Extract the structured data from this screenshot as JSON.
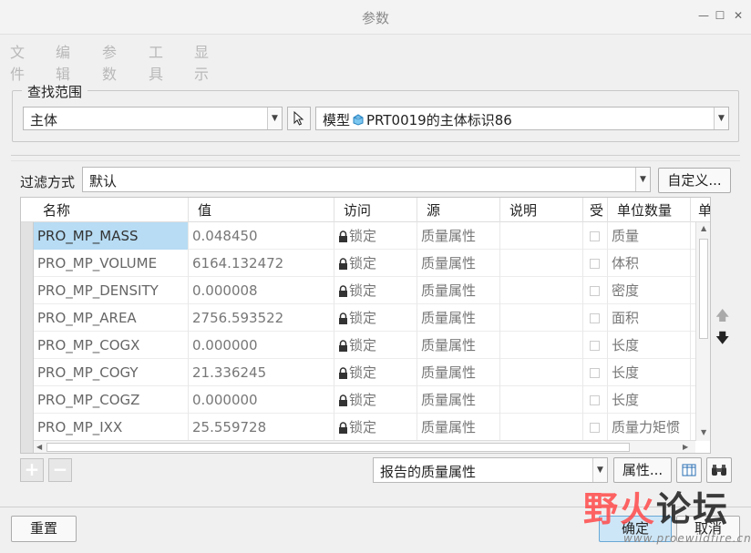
{
  "window": {
    "title": "参数"
  },
  "menu": [
    "文件",
    "编辑",
    "参数",
    "工具",
    "显示"
  ],
  "scope": {
    "legend": "查找范围",
    "selector_value": "主体",
    "model_prefix": "模型",
    "model_value": "PRT0019的主体标识86"
  },
  "filter": {
    "label": "过滤方式",
    "value": "默认",
    "customize_label": "自定义..."
  },
  "table": {
    "columns": [
      "名称",
      "值",
      "访问",
      "源",
      "说明",
      "受",
      "单位数量",
      "单"
    ],
    "rows": [
      {
        "name": "PRO_MP_MASS",
        "value": "0.048450",
        "access": "锁定",
        "source": "质量属性",
        "desc": "",
        "unit_qty": "质量"
      },
      {
        "name": "PRO_MP_VOLUME",
        "value": "6164.132472",
        "access": "锁定",
        "source": "质量属性",
        "desc": "",
        "unit_qty": "体积"
      },
      {
        "name": "PRO_MP_DENSITY",
        "value": "0.000008",
        "access": "锁定",
        "source": "质量属性",
        "desc": "",
        "unit_qty": "密度"
      },
      {
        "name": "PRO_MP_AREA",
        "value": "2756.593522",
        "access": "锁定",
        "source": "质量属性",
        "desc": "",
        "unit_qty": "面积"
      },
      {
        "name": "PRO_MP_COGX",
        "value": "0.000000",
        "access": "锁定",
        "source": "质量属性",
        "desc": "",
        "unit_qty": "长度"
      },
      {
        "name": "PRO_MP_COGY",
        "value": "21.336245",
        "access": "锁定",
        "source": "质量属性",
        "desc": "",
        "unit_qty": "长度"
      },
      {
        "name": "PRO_MP_COGZ",
        "value": "0.000000",
        "access": "锁定",
        "source": "质量属性",
        "desc": "",
        "unit_qty": "长度"
      },
      {
        "name": "PRO_MP_IXX",
        "value": "25.559728",
        "access": "锁定",
        "source": "质量属性",
        "desc": "",
        "unit_qty": "质量力矩惯"
      }
    ]
  },
  "bottom": {
    "report_value": "报告的质量属性",
    "properties_label": "属性...",
    "reset_label": "重置",
    "ok_label": "确定",
    "cancel_label": "取消"
  },
  "watermark": {
    "text_red": "野火",
    "text_black": "论坛",
    "url": "www.proewildfire.cn"
  }
}
